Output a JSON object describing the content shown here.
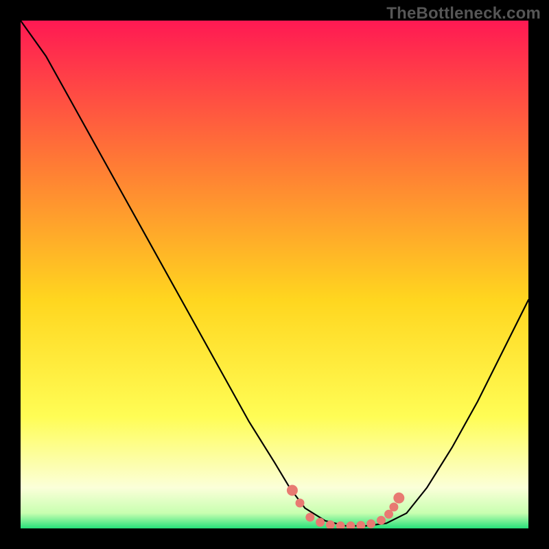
{
  "watermark": "TheBottleneck.com",
  "colors": {
    "frame": "#000000",
    "gradient_top": "#ff1953",
    "gradient_mid_upper": "#ff7a35",
    "gradient_mid": "#ffd61f",
    "gradient_mid_lower": "#fffd55",
    "gradient_pale": "#fbffd9",
    "gradient_green": "#26e07a",
    "curve": "#000000",
    "marker": "#e87a72"
  },
  "chart_data": {
    "type": "line",
    "title": "",
    "xlabel": "",
    "ylabel": "",
    "xlim": [
      0,
      100
    ],
    "ylim": [
      0,
      100
    ],
    "series": [
      {
        "name": "bottleneck-curve",
        "x": [
          0,
          5,
          10,
          15,
          20,
          25,
          30,
          35,
          40,
          45,
          50,
          53,
          56,
          60,
          64,
          68,
          72,
          76,
          80,
          85,
          90,
          95,
          100
        ],
        "y": [
          100,
          93,
          84,
          75,
          66,
          57,
          48,
          39,
          30,
          21,
          13,
          8,
          4,
          1.5,
          0.5,
          0.5,
          1,
          3,
          8,
          16,
          25,
          35,
          45
        ]
      }
    ],
    "markers": {
      "name": "highlight-dots",
      "x": [
        53.5,
        55,
        57,
        59,
        61,
        63,
        65,
        67,
        69,
        71,
        72.5,
        73.5,
        74.5
      ],
      "y": [
        7.5,
        5,
        2.2,
        1.2,
        0.7,
        0.5,
        0.5,
        0.6,
        0.9,
        1.6,
        2.8,
        4.2,
        6.0
      ]
    }
  }
}
